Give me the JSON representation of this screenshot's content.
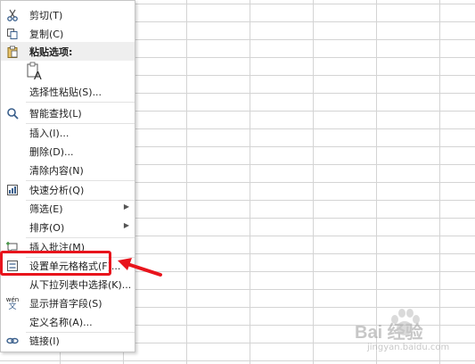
{
  "menu": {
    "items": [
      {
        "label": "剪切(T)",
        "icon": "scissors-icon"
      },
      {
        "label": "复制(C)",
        "icon": "copy-icon"
      },
      {
        "label": "粘贴选项:",
        "icon": "clipboard-icon"
      },
      {
        "label": "选择性粘贴(S)...",
        "icon": ""
      },
      {
        "label": "智能查找(L)",
        "icon": "smart-lookup-icon"
      },
      {
        "label": "插入(I)...",
        "icon": ""
      },
      {
        "label": "删除(D)...",
        "icon": ""
      },
      {
        "label": "清除内容(N)",
        "icon": ""
      },
      {
        "label": "快速分析(Q)",
        "icon": "quick-analysis-icon"
      },
      {
        "label": "筛选(E)",
        "icon": ""
      },
      {
        "label": "排序(O)",
        "icon": ""
      },
      {
        "label": "插入批注(M)",
        "icon": "comment-icon"
      },
      {
        "label": "设置单元格格式(F)...",
        "icon": "format-cells-icon"
      },
      {
        "label": "从下拉列表中选择(K)...",
        "icon": ""
      },
      {
        "label": "显示拼音字段(S)",
        "icon": "pinyin-icon"
      },
      {
        "label": "定义名称(A)...",
        "icon": ""
      },
      {
        "label": "链接(I)",
        "icon": "link-icon"
      }
    ],
    "paste_glyph": "A",
    "pinyin_glyph_top": "wén",
    "pinyin_glyph_bottom": "文"
  },
  "colors": {
    "highlight": "#e8141c",
    "arrow": "#e8141c",
    "icon": "#3a5f8c"
  },
  "watermark": {
    "text": "Bai 经验",
    "subtext": "jingyan.baidu.com"
  }
}
